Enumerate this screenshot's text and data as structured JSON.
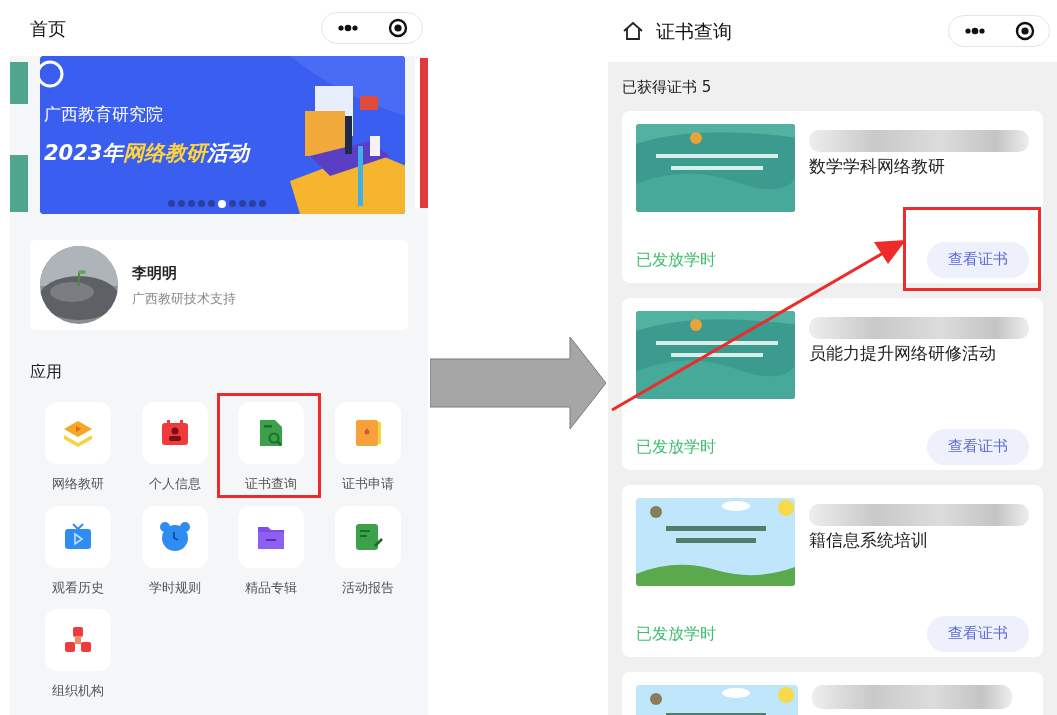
{
  "home": {
    "title": "首页",
    "banner": {
      "line_1": "广西教育研究院",
      "line_2_prefix": "2023年",
      "line_2_highlight": "网络教研",
      "line_2_suffix": "活动",
      "dots": [
        {
          "selected": false
        },
        {
          "selected": false
        },
        {
          "selected": false
        },
        {
          "selected": false
        },
        {
          "selected": false
        },
        {
          "selected": true
        },
        {
          "selected": false
        },
        {
          "selected": false
        },
        {
          "selected": false
        },
        {
          "selected": false
        }
      ]
    },
    "profile": {
      "name": "李明明",
      "subtitle": "广西教研技术支持"
    },
    "section_title": "应用",
    "apps": [
      {
        "label": "网络教研",
        "kind": "layers",
        "highlighted": false
      },
      {
        "label": "个人信息",
        "kind": "badge",
        "highlighted": false
      },
      {
        "label": "证书查询",
        "kind": "doc-search",
        "highlighted": true
      },
      {
        "label": "证书申请",
        "kind": "notebook",
        "highlighted": false
      },
      {
        "label": "观看历史",
        "kind": "tv",
        "highlighted": false
      },
      {
        "label": "学时规则",
        "kind": "clock",
        "highlighted": false
      },
      {
        "label": "精品专辑",
        "kind": "folder",
        "highlighted": false
      },
      {
        "label": "活动报告",
        "kind": "note",
        "highlighted": false
      },
      {
        "label": "组织机构",
        "kind": "org",
        "highlighted": false
      }
    ]
  },
  "certificates_page": {
    "title": "证书查询",
    "count_label": "已获得证书 5",
    "certificates": [
      {
        "title": "数学学科网络教研",
        "thumbnail": {
          "kind": "teal"
        },
        "status": "已发放学时",
        "button": "查看证书",
        "highlighted": true
      },
      {
        "title": "员能力提升网络研修活动",
        "thumbnail": {
          "kind": "teal"
        },
        "status": "已发放学时",
        "button": "查看证书",
        "highlighted": false
      },
      {
        "title": "籍信息系统培训",
        "thumbnail": {
          "kind": "sky"
        },
        "status": "已发放学时",
        "button": "查看证书",
        "highlighted": false
      }
    ],
    "more_below": true
  }
}
